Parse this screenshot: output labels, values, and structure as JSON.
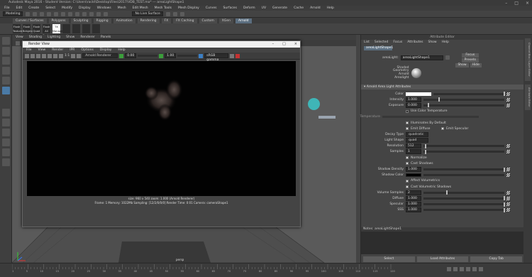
{
  "window": {
    "title": "Autodesk Maya 2016 - Student Version: C:\\Users\\rackt\\Desktop\\Files\\2017\\VDB_TEST.ma* --- areaLightShape1"
  },
  "menubar": [
    "File",
    "Edit",
    "Create",
    "Select",
    "Modify",
    "Display",
    "Windows",
    "Mesh",
    "Edit Mesh",
    "Mesh Tools",
    "Mesh Display",
    "Curves",
    "Surfaces",
    "Deform",
    "UV",
    "Generate",
    "Cache",
    "Arnold",
    "Help"
  ],
  "statusline": {
    "mode": "Modeling",
    "live_surface": "No Live Surface"
  },
  "shelf_tabs": [
    "Curves / Surfaces",
    "Polygons",
    "Sculpting",
    "Rigging",
    "Animation",
    "Rendering",
    "FX",
    "FX Caching",
    "Custom",
    "XGen",
    "Arnold"
  ],
  "shelf_tabs_active": "Arnold",
  "shelf_buttons": [
    "Flush Texture",
    "Flush Bckgrnd",
    "Flush Quad",
    "Flush All Caches",
    "TX Manager"
  ],
  "viewport": {
    "menu": [
      "View",
      "Shading",
      "Lighting",
      "Show",
      "Renderer",
      "Panels"
    ],
    "camera_label": "persp",
    "accent_dot": "#3fb5b7"
  },
  "render_view": {
    "title": "Render View",
    "menu": [
      "File",
      "View",
      "Render",
      "IPR",
      "Options",
      "Display",
      "Help"
    ],
    "renderer": "Arnold Renderer",
    "zoom": "1:1",
    "exposure": "0.00",
    "gamma": "1.00",
    "color_mgmt": "sRGB gamma",
    "info_line1": "size: 960 x 540  zoom: 1.000   (Arnold Renderer)",
    "info_line2": "Frame: 1    Memory: 1022Mb    Sampling: [12/2/0/0/0]    Render Time: 0:01    Camera: cameraShape1"
  },
  "timeline": {
    "frame_numbers": [
      "1",
      "5",
      "10",
      "15",
      "20",
      "25",
      "30",
      "35",
      "40",
      "45",
      "50",
      "55",
      "60",
      "65",
      "70",
      "75",
      "80",
      "85",
      "90",
      "95",
      "100",
      "105",
      "110",
      "115",
      "120"
    ]
  },
  "attribute_editor": {
    "header": "Attribute Editor",
    "menu": [
      "List",
      "Selected",
      "Focus",
      "Attributes",
      "Show",
      "Help"
    ],
    "tab": "areaLightShape1",
    "node_label": "areaLight:",
    "node_name": "areaLightShape1",
    "focus_btn": "Focus",
    "presets_btn": "Presets",
    "show_btn": "Show",
    "hide_btn": "Hide",
    "swatch_caption": [
      "Shaded",
      "Geometry",
      "Arnold",
      "Arealight"
    ],
    "section": "Arnold Area Light Attributes",
    "rows": [
      {
        "label": "Color",
        "value": "",
        "type": "color"
      },
      {
        "label": "Intensity",
        "value": "1.000",
        "type": "slider",
        "pos": 0.18
      },
      {
        "label": "Exposure",
        "value": "0.000",
        "type": "slider",
        "pos": 0.05
      },
      {
        "label": "",
        "value": "Use Color Temperature",
        "type": "check",
        "on": false
      },
      {
        "label": "Temperature",
        "value": "",
        "type": "temp"
      },
      {
        "label": "",
        "value": "Illuminates By Default",
        "type": "check",
        "on": true
      },
      {
        "label": "",
        "value": "Emit Diffuse",
        "value2": "Emit Specular",
        "type": "check2",
        "on": true
      },
      {
        "label": "Decay Type",
        "value": "quadratic",
        "type": "enum"
      },
      {
        "label": "Light Shape",
        "value": "quad",
        "type": "enum"
      },
      {
        "label": "Resolution",
        "value": "512",
        "type": "slider",
        "pos": 0.02
      },
      {
        "label": "Samples",
        "value": "1",
        "type": "slider",
        "pos": 0.02
      },
      {
        "label": "",
        "value": "Normalize",
        "type": "check",
        "on": true
      },
      {
        "label": "",
        "value": "Cast Shadows",
        "type": "check",
        "on": true
      },
      {
        "label": "Shadow Density",
        "value": "1.000",
        "type": "slider",
        "pos": 0.99
      },
      {
        "label": "Shadow Color",
        "value": "",
        "type": "shadowcolor"
      },
      {
        "label": "",
        "value": "Affect Volumetrics",
        "type": "check",
        "on": true
      },
      {
        "label": "",
        "value": "Cast Volumetric Shadows",
        "type": "check",
        "on": true
      },
      {
        "label": "Volume Samples",
        "value": "2",
        "type": "slider",
        "pos": 0.28
      },
      {
        "label": "Diffuse",
        "value": "1.000",
        "type": "slider",
        "pos": 0.99
      },
      {
        "label": "Specular",
        "value": "1.000",
        "type": "slider",
        "pos": 0.99
      },
      {
        "label": "SSS",
        "value": "1.000",
        "type": "slider",
        "pos": 0.99
      }
    ],
    "notes_label": "Notes: areaLightShape1",
    "footer": [
      "Select",
      "Load Attributes",
      "Copy Tab"
    ]
  },
  "right_tabs": [
    "Channel Box / Layer Editor",
    "Attribute Editor"
  ]
}
